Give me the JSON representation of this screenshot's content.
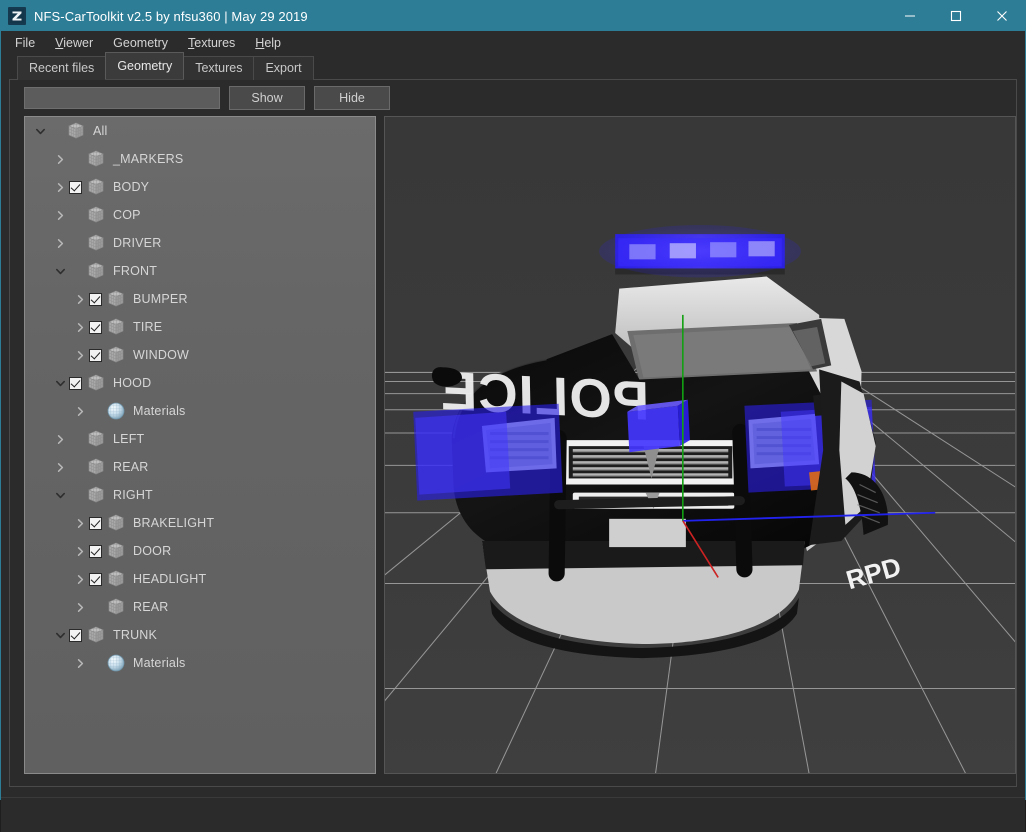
{
  "window": {
    "title": "NFS-CarToolkit v2.5 by nfsu360 | May 29 2019",
    "app_icon": "app-logo-icon",
    "accent_color": "#2e7d96",
    "controls": {
      "minimize": "—",
      "maximize": "☐",
      "close": "×"
    }
  },
  "menu": {
    "items": [
      {
        "label": "File",
        "mnemonic": ""
      },
      {
        "label": "Viewer",
        "mnemonic": "V"
      },
      {
        "label": "Geometry",
        "mnemonic": ""
      },
      {
        "label": "Textures",
        "mnemonic": "T"
      },
      {
        "label": "Help",
        "mnemonic": "H"
      }
    ]
  },
  "tabs": {
    "active": "Geometry",
    "items": [
      {
        "label": "Recent files"
      },
      {
        "label": "Geometry"
      },
      {
        "label": "Textures"
      },
      {
        "label": "Export"
      }
    ]
  },
  "toolbar": {
    "search_value": "",
    "search_placeholder": "",
    "show_label": "Show",
    "hide_label": "Hide"
  },
  "tree": {
    "rows": [
      {
        "label": "All",
        "depth": 0,
        "twisty": "down",
        "checkbox": "none",
        "icon": "mesh-icon"
      },
      {
        "label": "_MARKERS",
        "depth": 1,
        "twisty": "right",
        "checkbox": "none",
        "icon": "mesh-icon"
      },
      {
        "label": "BODY",
        "depth": 1,
        "twisty": "right",
        "checkbox": "checked",
        "icon": "mesh-icon"
      },
      {
        "label": "COP",
        "depth": 1,
        "twisty": "right",
        "checkbox": "none",
        "icon": "mesh-icon"
      },
      {
        "label": "DRIVER",
        "depth": 1,
        "twisty": "right",
        "checkbox": "none",
        "icon": "mesh-icon"
      },
      {
        "label": "FRONT",
        "depth": 1,
        "twisty": "down",
        "checkbox": "none",
        "icon": "mesh-icon"
      },
      {
        "label": "BUMPER",
        "depth": 2,
        "twisty": "right",
        "checkbox": "checked",
        "icon": "mesh-icon"
      },
      {
        "label": "TIRE",
        "depth": 2,
        "twisty": "right",
        "checkbox": "checked",
        "icon": "mesh-icon"
      },
      {
        "label": "WINDOW",
        "depth": 2,
        "twisty": "right",
        "checkbox": "checked",
        "icon": "mesh-icon"
      },
      {
        "label": "HOOD",
        "depth": 1,
        "twisty": "down",
        "checkbox": "checked",
        "icon": "mesh-icon"
      },
      {
        "label": "Materials",
        "depth": 2,
        "twisty": "right",
        "checkbox": "none",
        "icon": "material-sphere-icon"
      },
      {
        "label": "LEFT",
        "depth": 1,
        "twisty": "right",
        "checkbox": "none",
        "icon": "mesh-icon"
      },
      {
        "label": "REAR",
        "depth": 1,
        "twisty": "right",
        "checkbox": "none",
        "icon": "mesh-icon"
      },
      {
        "label": "RIGHT",
        "depth": 1,
        "twisty": "down",
        "checkbox": "none",
        "icon": "mesh-icon"
      },
      {
        "label": "BRAKELIGHT",
        "depth": 2,
        "twisty": "right",
        "checkbox": "checked",
        "icon": "mesh-icon"
      },
      {
        "label": "DOOR",
        "depth": 2,
        "twisty": "right",
        "checkbox": "checked",
        "icon": "mesh-icon"
      },
      {
        "label": "HEADLIGHT",
        "depth": 2,
        "twisty": "right",
        "checkbox": "checked",
        "icon": "mesh-icon"
      },
      {
        "label": "REAR",
        "depth": 2,
        "twisty": "right",
        "checkbox": "none",
        "icon": "mesh-icon"
      },
      {
        "label": "TRUNK",
        "depth": 1,
        "twisty": "down",
        "checkbox": "checked",
        "icon": "mesh-icon"
      },
      {
        "label": "Materials",
        "depth": 2,
        "twisty": "right",
        "checkbox": "none",
        "icon": "material-sphere-icon"
      }
    ]
  },
  "viewport": {
    "background_color": "#3a3a3a",
    "grid_color": "#b9b9b9",
    "model_decals": {
      "hood_text": "POLICE",
      "side_text": "RPD"
    },
    "gizmo": {
      "x_axis_color": "#2222ee",
      "y_axis_color": "#13a013",
      "z_axis_color": "#cc2222"
    }
  },
  "status_bar": {
    "text": ""
  }
}
